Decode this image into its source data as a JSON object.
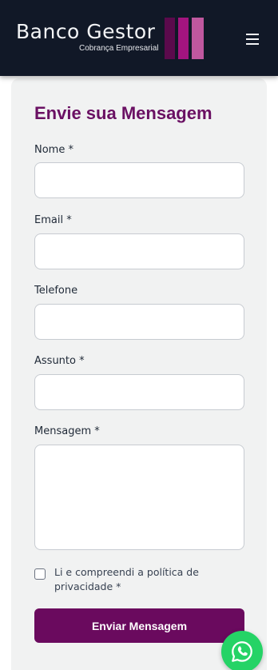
{
  "header": {
    "brand_name": "Banco Gestor",
    "brand_tagline": "Cobrança Empresarial",
    "menu_icon": "hamburger-menu-icon",
    "bar_colors": [
      "#5b0a4c",
      "#a3147f",
      "#c0589f"
    ]
  },
  "form": {
    "title": "Envie sua Mensagem",
    "fields": [
      {
        "label": "Nome *",
        "value": "",
        "placeholder": ""
      },
      {
        "label": "Email *",
        "value": "",
        "placeholder": ""
      },
      {
        "label": "Telefone",
        "value": "",
        "placeholder": ""
      },
      {
        "label": "Assunto *",
        "value": "",
        "placeholder": ""
      },
      {
        "label": "Mensagem *",
        "value": "",
        "placeholder": ""
      }
    ],
    "privacy_checkbox_label": "Li e compreendi a política de privacidade *",
    "privacy_checked": false,
    "submit_label": "Enviar Mensagem"
  },
  "whatsapp": {
    "icon": "whatsapp-icon"
  },
  "colors": {
    "header_bg": "#111827",
    "accent": "#6a0a5e",
    "title": "#6a1063",
    "card_bg": "#f1f2f2",
    "whatsapp": "#25d366"
  }
}
